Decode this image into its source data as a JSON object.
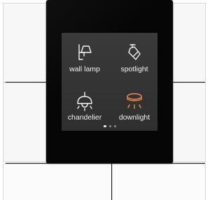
{
  "panel": {
    "tiles": [
      {
        "label": "wall lamp",
        "icon": "wall-lamp-icon",
        "state": "off"
      },
      {
        "label": "spotlight",
        "icon": "spotlight-icon",
        "state": "off"
      },
      {
        "label": "chandelier",
        "icon": "chandelier-icon",
        "state": "off"
      },
      {
        "label": "downlight",
        "icon": "downlight-icon",
        "state": "on"
      }
    ],
    "page_indicator": {
      "pages": 3,
      "current": 1
    }
  },
  "colors": {
    "bezel": "#060606",
    "screen": "#353535",
    "icon_default": "#f2f2f2",
    "icon_active": "#f08a4b",
    "wall": "#f7f7f7"
  }
}
